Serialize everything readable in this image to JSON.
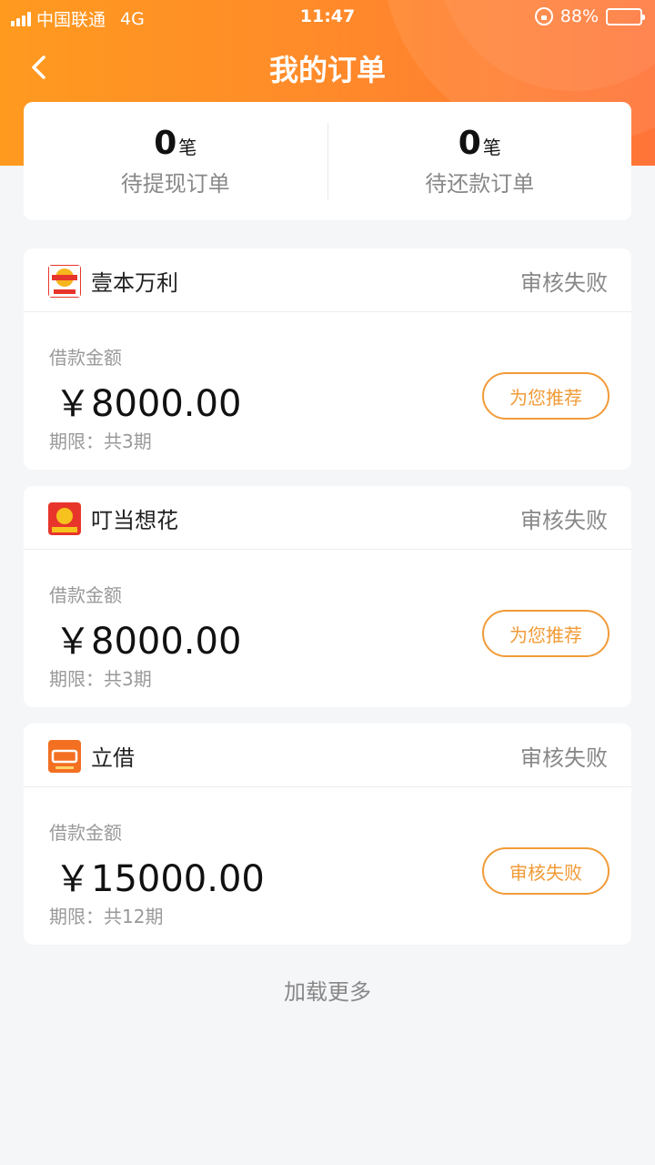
{
  "status_bar": {
    "carrier": "中国联通",
    "network": "4G",
    "time": "11:47",
    "battery": "88%",
    "battery_level": 0.88
  },
  "nav": {
    "title": "我的订单",
    "back_icon": "chevron-left-icon"
  },
  "summary": {
    "pending_withdraw": {
      "count": "0",
      "unit": "笔",
      "label": "待提现订单"
    },
    "pending_repay": {
      "count": "0",
      "unit": "笔",
      "label": "待还款订单"
    }
  },
  "orders": [
    {
      "app_name": "壹本万利",
      "status": "审核失败",
      "amount_label": "借款金额",
      "amount": "￥8000.00",
      "term": "期限：共3期",
      "action": "为您推荐",
      "logo_colors": [
        "#ffffff",
        "#e8352b",
        "#f6b51d"
      ]
    },
    {
      "app_name": "叮当想花",
      "status": "审核失败",
      "amount_label": "借款金额",
      "amount": "￥8000.00",
      "term": "期限：共3期",
      "action": "为您推荐",
      "logo_colors": [
        "#e8352b",
        "#f6c21d"
      ]
    },
    {
      "app_name": "立借",
      "status": "审核失败",
      "amount_label": "借款金额",
      "amount": "￥15000.00",
      "term": "期限：共12期",
      "action": "审核失败",
      "logo_colors": [
        "#f36f21",
        "#ffffff"
      ]
    }
  ],
  "load_more": "加载更多",
  "colors": {
    "header_gradient_start": "#ff9a1f",
    "header_gradient_end": "#ff7438",
    "accent": "#f19b38",
    "background": "#f5f6f8"
  }
}
